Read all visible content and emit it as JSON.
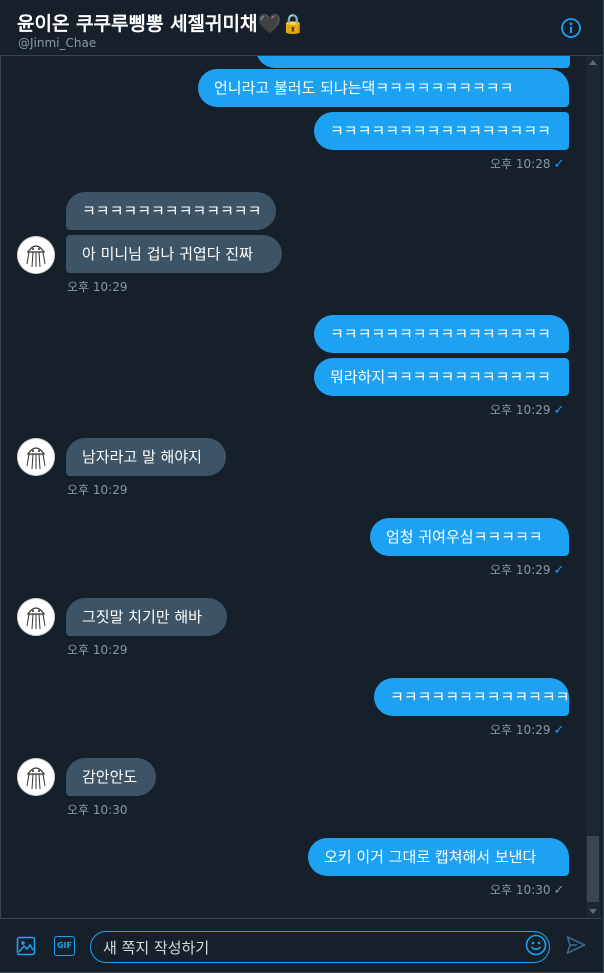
{
  "header": {
    "title": "윤이온 쿠쿠루삥뽕 세젤귀미채🖤🔒",
    "handle": "@Jinmi_Chae",
    "info_icon": "info-icon"
  },
  "messages": [
    {
      "side": "out",
      "text": "",
      "pos": "partial"
    },
    {
      "side": "out",
      "text": "언니라고 불러도 되냐는댁ㅋㅋㅋㅋㅋㅋㅋㅋㅋㅋ"
    },
    {
      "side": "out",
      "text": "ㅋㅋㅋㅋㅋㅋㅋㅋㅋㅋㅋㅋㅋㅋㅋㅋ"
    },
    {
      "side": "out",
      "time": "오후 10:28",
      "check": "✓"
    },
    {
      "side": "in",
      "text": "ㅋㅋㅋㅋㅋㅋㅋㅋㅋㅋㅋㅋㅋ"
    },
    {
      "side": "in",
      "text": "아 미니님 겁나 귀엽다 진짜"
    },
    {
      "side": "in",
      "time": "오후 10:29"
    },
    {
      "side": "out",
      "text": "ㅋㅋㅋㅋㅋㅋㅋㅋㅋㅋㅋㅋㅋㅋㅋㅋ"
    },
    {
      "side": "out",
      "text": "뭐라하지ㅋㅋㅋㅋㅋㅋㅋㅋㅋㅋㅋㅋ"
    },
    {
      "side": "out",
      "time": "오후 10:29",
      "check": "✓"
    },
    {
      "side": "in",
      "text": "남자라고 말 해야지"
    },
    {
      "side": "in",
      "time": "오후 10:29"
    },
    {
      "side": "out",
      "text": "엄청 귀여우심ㅋㅋㅋㅋㅋ"
    },
    {
      "side": "out",
      "time": "오후 10:29",
      "check": "✓"
    },
    {
      "side": "in",
      "text": "그짓말 치기만 해바"
    },
    {
      "side": "in",
      "time": "오후 10:29"
    },
    {
      "side": "out",
      "text": "ㅋㅋㅋㅋㅋㅋㅋㅋㅋㅋㅋㅋㅋ"
    },
    {
      "side": "out",
      "time": "오후 10:29",
      "check": "✓"
    },
    {
      "side": "in",
      "text": "감안안도"
    },
    {
      "side": "in",
      "time": "오후 10:30"
    },
    {
      "side": "out",
      "text": "오키 이거 그대로 캡쳐해서 보낸다"
    },
    {
      "side": "out",
      "time": "오후 10:30",
      "check": "✓"
    }
  ],
  "composer": {
    "placeholder": "새 쪽지 작성하기",
    "media_icon": "image-icon",
    "gif_label": "GIF",
    "emoji_icon": "emoji-icon",
    "send_icon": "send-icon"
  },
  "colors": {
    "background": "#15202b",
    "outgoing": "#1da1f2",
    "incoming": "#3d5466",
    "muted": "#8899a6"
  }
}
